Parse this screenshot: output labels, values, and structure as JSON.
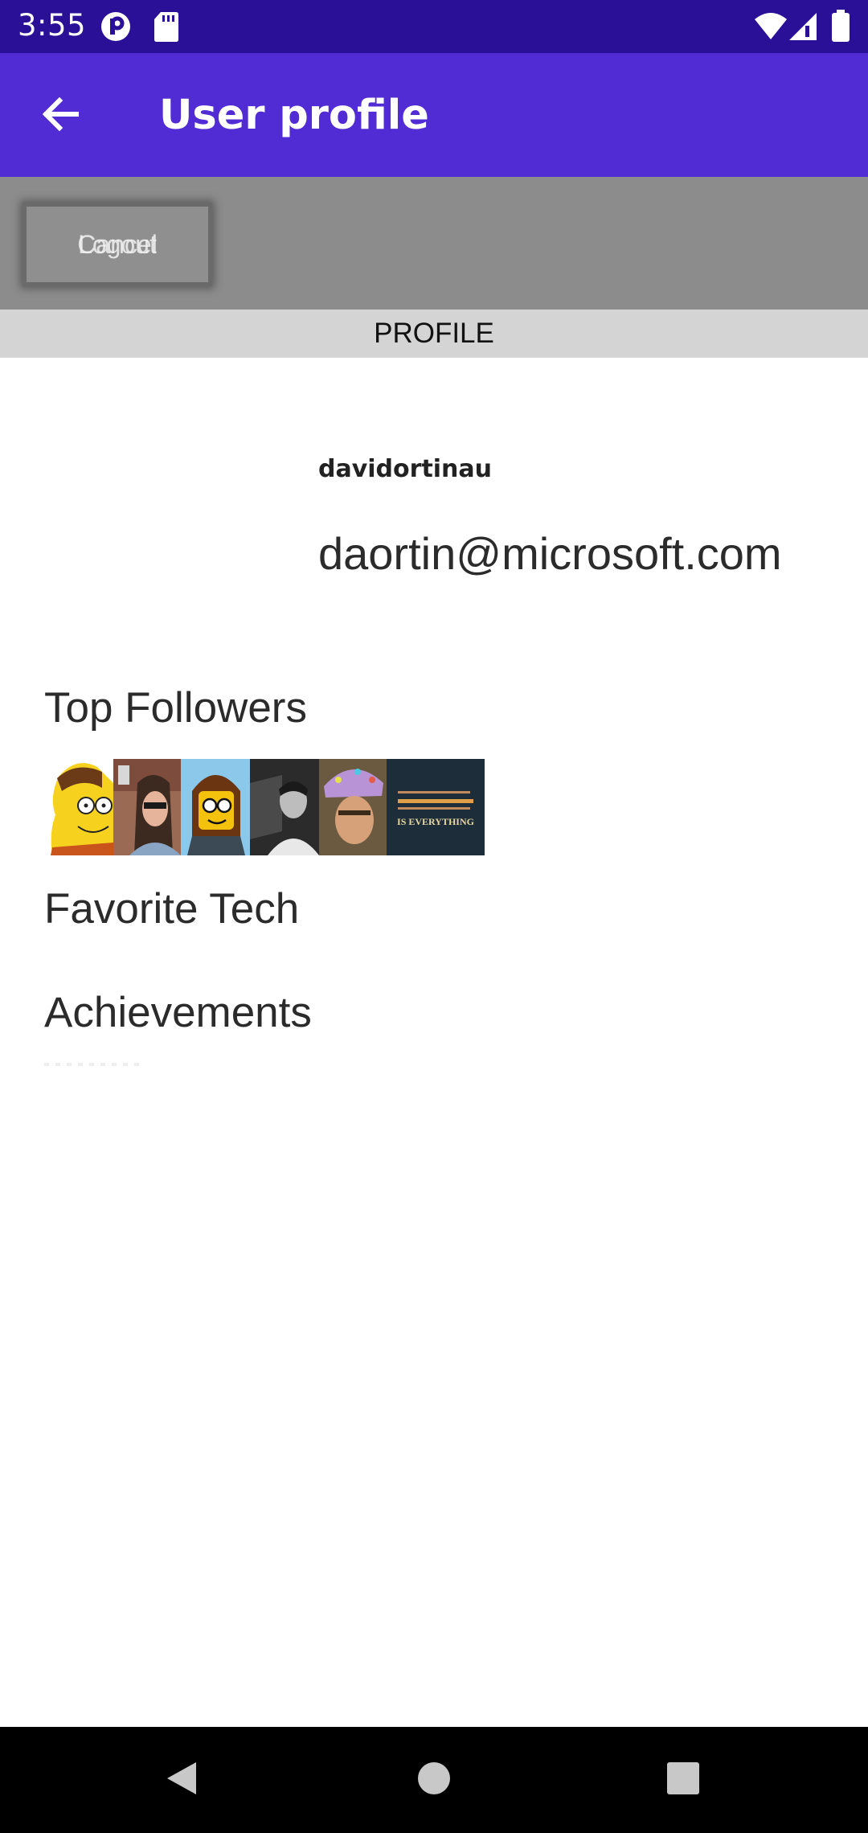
{
  "status_bar": {
    "time": "3:55",
    "icons": [
      "app-notification-icon",
      "sd-card-icon",
      "wifi-icon",
      "cell-signal-icon",
      "battery-icon"
    ]
  },
  "app_bar": {
    "title": "User profile",
    "back_icon": "arrow-back-icon",
    "background_color": "#512bd4"
  },
  "toolbar": {
    "cancel_label": "Cancel",
    "overlap_label": "Logout"
  },
  "tabs": {
    "active": "PROFILE"
  },
  "profile": {
    "username": "davidortinau",
    "email": "daortin@microsoft.com"
  },
  "sections": {
    "top_followers": "Top Followers",
    "favorite_tech": "Favorite Tech",
    "achievements": "Achievements"
  },
  "followers": {
    "avatars": [
      "cartoon-avatar",
      "photo-avatar",
      "lego-avatar",
      "photo-avatar",
      "photo-avatar",
      "quote-avatar"
    ],
    "quote_avatar_text": "IS EVERYTHING"
  },
  "nav_bar": {
    "icons": [
      "back-triangle-icon",
      "home-circle-icon",
      "recents-square-icon"
    ]
  }
}
